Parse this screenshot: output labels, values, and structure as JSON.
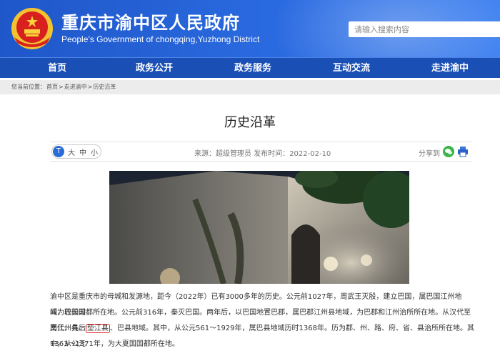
{
  "header": {
    "title": "重庆市渝中区人民政府",
    "subtitle": "People’s Government of chongqing,Yuzhong District",
    "search_placeholder": "请输入搜索内容"
  },
  "nav": {
    "items": [
      "首页",
      "政务公开",
      "政务服务",
      "互动交流",
      "走进渝中"
    ]
  },
  "breadcrumb": {
    "prefix": "您当前位置：",
    "items": [
      "首页",
      "走进渝中",
      "历史沿革"
    ],
    "separator": ">"
  },
  "article": {
    "title": "历史沿革",
    "font_size_options": [
      "大",
      "中",
      "小"
    ],
    "source": "来源：超级管理员 发布时间：2022-02-10",
    "share_label": "分享到",
    "paragraph_1_lines": [
      "渝中区是重庆市的母城和发源地，距今（2022年）已有3000多年的历史。公元前1027年，周武王灭殷，建立巴国，属巴国江州地域，较长时",
      "间为巴国国都所在地。公元前316年，秦灭巴国。两年后，以巴国地置巴郡，属巴郡江州县地域，为巴郡和江州治所所在地。从汉代至南代，先后"
    ],
    "paragraph_line_3_before": "属江州县、",
    "paragraph_highlight": "垫江县",
    "paragraph_line_3_after": "、巴县地域。其中，从公元561～1929年，属巴县地域历时1368年。历为郡、州、路、府、省、县治所所在地。其中，从公元",
    "paragraph_line_4": "1363～1371年，为大夏国国都所在地。"
  },
  "colors": {
    "brand_blue": "#1f57c9",
    "nav_blue": "#1a4fb5",
    "highlight_red": "#e02020"
  }
}
